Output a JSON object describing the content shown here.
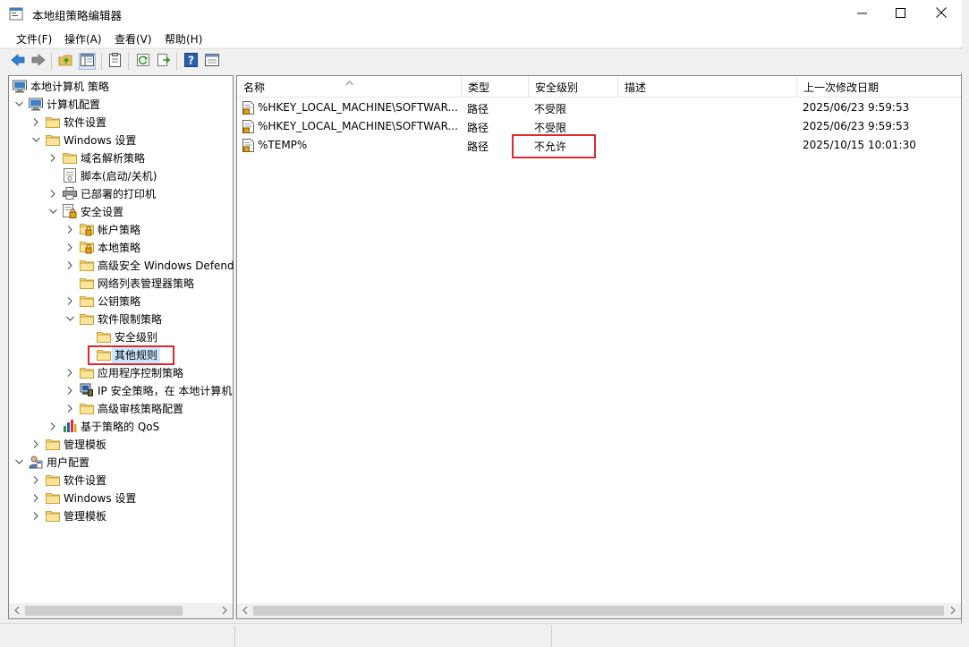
{
  "window": {
    "title": "本地组策略编辑器",
    "icon": "policy-editor-icon",
    "controls": [
      "minimize-icon",
      "maximize-icon",
      "close-icon"
    ]
  },
  "menu": [
    "文件(F)",
    "操作(A)",
    "查看(V)",
    "帮助(H)"
  ],
  "toolbar": [
    "back-icon",
    "forward-icon",
    "up-folder-icon",
    "show-tree-icon",
    "properties-icon",
    "refresh-icon",
    "export-icon",
    "help-icon",
    "view-icon"
  ],
  "tree": {
    "root": "本地计算机 策略",
    "computer_config": "计算机配置",
    "software_settings": "软件设置",
    "windows_settings": "Windows 设置",
    "dns_policy": "域名解析策略",
    "scripts": "脚本(启动/关机)",
    "printers": "已部署的打印机",
    "security_settings": "安全设置",
    "account_policy": "帐户策略",
    "local_policy": "本地策略",
    "firewall": "高级安全 Windows Defend",
    "network_list": "网络列表管理器策略",
    "public_key": "公钥策略",
    "srp": "软件限制策略",
    "security_levels": "安全级别",
    "other_rules": "其他规则",
    "app_control": "应用程序控制策略",
    "ipsec": "IP 安全策略，在 本地计算机",
    "audit": "高级审核策略配置",
    "qos": "基于策略的 QoS",
    "admin_templates": "管理模板",
    "user_config": "用户配置",
    "user_software": "软件设置",
    "user_windows": "Windows 设置",
    "user_admin": "管理模板"
  },
  "list": {
    "columns": [
      "名称",
      "类型",
      "安全级别",
      "描述",
      "上一次修改日期"
    ],
    "rows": [
      {
        "name": "%HKEY_LOCAL_MACHINE\\SOFTWAR...",
        "type": "路径",
        "level": "不受限",
        "desc": "",
        "modified": "2025/06/23  9:59:53"
      },
      {
        "name": "%HKEY_LOCAL_MACHINE\\SOFTWAR...",
        "type": "路径",
        "level": "不受限",
        "desc": "",
        "modified": "2025/06/23  9:59:53"
      },
      {
        "name": "%TEMP%",
        "type": "路径",
        "level": "不允许",
        "desc": "",
        "modified": "2025/10/15  10:01:30"
      }
    ]
  },
  "colors": {
    "highlight_box": "#e0262e",
    "selected": "#cce8ff",
    "folder": "#f5d77a"
  }
}
